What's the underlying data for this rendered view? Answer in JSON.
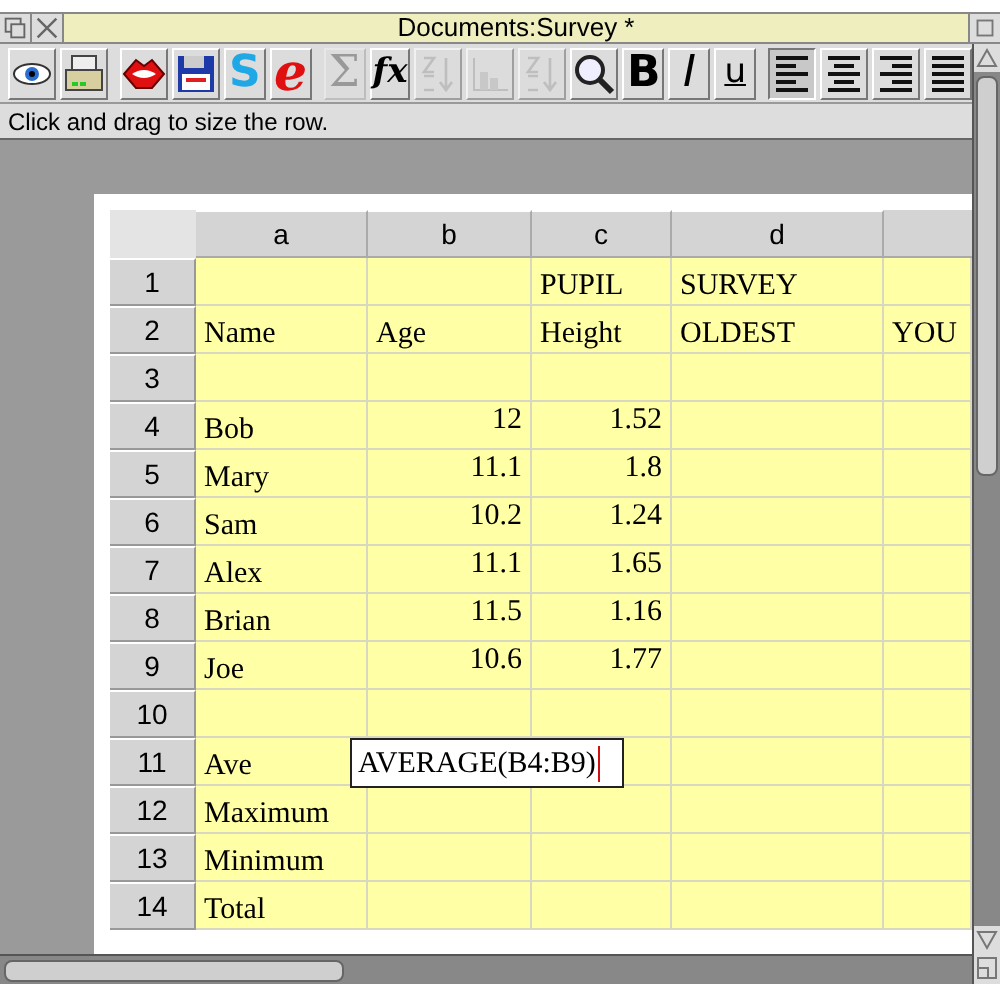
{
  "window": {
    "title": "Documents:Survey *"
  },
  "toolbar": [
    {
      "kind": "icon",
      "disabled": false,
      "selected": false
    },
    {
      "kind": "icon",
      "disabled": false,
      "selected": false
    },
    {
      "kind": "icon",
      "disabled": false,
      "selected": false
    },
    {
      "kind": "icon",
      "disabled": false,
      "selected": false
    },
    {
      "kind": "letter",
      "label": "S",
      "disabled": false,
      "selected": false
    },
    {
      "kind": "letter",
      "label": "e",
      "disabled": false,
      "selected": false
    },
    {
      "kind": "letter",
      "label": "Σ",
      "disabled": true,
      "selected": false
    },
    {
      "kind": "letter",
      "label": "fx",
      "disabled": false,
      "selected": false
    },
    {
      "kind": "icon",
      "disabled": true,
      "selected": false
    },
    {
      "kind": "icon",
      "disabled": true,
      "selected": false
    },
    {
      "kind": "icon",
      "disabled": true,
      "selected": false
    },
    {
      "kind": "icon",
      "disabled": false,
      "selected": false
    },
    {
      "kind": "letter",
      "label": "B",
      "disabled": false,
      "selected": false
    },
    {
      "kind": "letter",
      "label": "I",
      "disabled": false,
      "selected": false
    },
    {
      "kind": "letter",
      "label": "u",
      "disabled": false,
      "selected": false
    },
    {
      "kind": "icon",
      "disabled": false,
      "selected": true
    },
    {
      "kind": "icon",
      "disabled": false,
      "selected": false
    },
    {
      "kind": "icon",
      "disabled": false,
      "selected": false
    },
    {
      "kind": "icon",
      "disabled": false,
      "selected": false
    }
  ],
  "status_bar": "Click and drag to size the row.",
  "sheet": {
    "columns": [
      "a",
      "b",
      "c",
      "d"
    ],
    "rows": [
      {
        "header": "1",
        "kind": "label",
        "cells": [
          null,
          null,
          "PUPIL",
          "SURVEY"
        ]
      },
      {
        "header": "2",
        "kind": "label",
        "cells": [
          "Name",
          "Age",
          "Height",
          "OLDEST",
          "YOU"
        ]
      },
      {
        "header": "3",
        "kind": "label",
        "cells": []
      },
      {
        "header": "4",
        "kind": "data",
        "cells": [
          "Bob",
          "12",
          "1.52"
        ]
      },
      {
        "header": "5",
        "kind": "data",
        "cells": [
          "Mary",
          "11.1",
          "1.8"
        ]
      },
      {
        "header": "6",
        "kind": "data",
        "cells": [
          "Sam",
          "10.2",
          "1.24"
        ]
      },
      {
        "header": "7",
        "kind": "data",
        "cells": [
          "Alex",
          "11.1",
          "1.65"
        ]
      },
      {
        "header": "8",
        "kind": "data",
        "cells": [
          "Brian",
          "11.5",
          "1.16"
        ]
      },
      {
        "header": "9",
        "kind": "data",
        "cells": [
          "Joe",
          "10.6",
          "1.77"
        ]
      },
      {
        "header": "10",
        "kind": "label",
        "cells": []
      },
      {
        "header": "11",
        "kind": "label",
        "cells": [
          "Ave"
        ]
      },
      {
        "header": "12",
        "kind": "label",
        "cells": [
          "Maximum"
        ]
      },
      {
        "header": "13",
        "kind": "label",
        "cells": [
          "Minimum"
        ]
      },
      {
        "header": "14",
        "kind": "label",
        "cells": [
          "Total"
        ]
      }
    ],
    "editor": {
      "value": "AVERAGE(B4:B9)"
    }
  }
}
